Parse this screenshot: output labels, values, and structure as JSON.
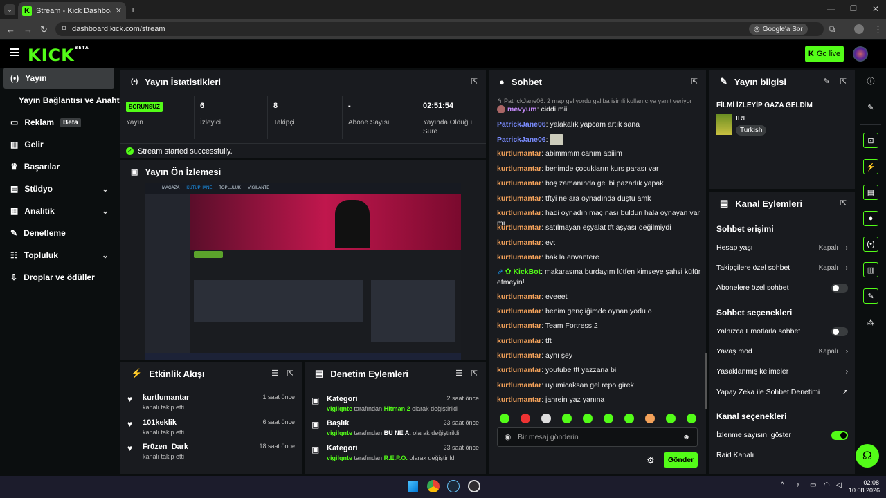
{
  "browser": {
    "tab_title": "Stream - Kick Dashboard",
    "url": "dashboard.kick.com/stream",
    "ask_google": "Google'a Sor"
  },
  "header": {
    "logo": "KICK",
    "logo_badge": "BETA",
    "go_live": "Go live"
  },
  "sidebar": {
    "items": [
      {
        "label": "Yayın",
        "icon": "broadcast-icon"
      },
      {
        "label": "Yayın Bağlantısı ve Anahtarı",
        "icon": ""
      },
      {
        "label": "Reklam",
        "badge": "Beta",
        "icon": "ad-icon"
      },
      {
        "label": "Gelir",
        "icon": "revenue-icon"
      },
      {
        "label": "Başarılar",
        "icon": "trophy-icon"
      },
      {
        "label": "Stüdyo",
        "icon": "studio-icon"
      },
      {
        "label": "Analitik",
        "icon": "analytics-icon"
      },
      {
        "label": "Denetleme",
        "icon": "wrench-icon"
      },
      {
        "label": "Topluluk",
        "icon": "community-icon"
      },
      {
        "label": "Droplar ve ödüller",
        "icon": "drops-icon"
      }
    ]
  },
  "stats": {
    "title": "Yayın İstatistikleri",
    "status": "SORUNSUZ",
    "status_label": "Yayın",
    "items": [
      {
        "value": "6",
        "label": "İzleyici"
      },
      {
        "value": "8",
        "label": "Takipçi"
      },
      {
        "value": "-",
        "label": "Abone Sayısı"
      },
      {
        "value": "02:51:54",
        "label": "Yayında Olduğu Süre"
      }
    ],
    "toast": "Stream started successfully."
  },
  "preview": {
    "title": "Yayın Ön İzlemesi",
    "tabs": [
      "MAĞAZA",
      "KÜTÜPHANE",
      "TOPLULUK",
      "VİGİLANTE"
    ]
  },
  "feed": {
    "title": "Etkinlik Akışı",
    "items": [
      {
        "name": "kurtlumantar",
        "sub": "kanalı takip etti",
        "time": "1 saat önce"
      },
      {
        "name": "101keklik",
        "sub": "kanalı takip etti",
        "time": "6 saat önce"
      },
      {
        "name": "Fr0zen_Dark",
        "sub": "kanalı takip etti",
        "time": "18 saat önce"
      }
    ]
  },
  "mod": {
    "title": "Denetim Eylemleri",
    "items": [
      {
        "type": "Kategori",
        "user": "vigilqnte",
        "mid": "tarafından",
        "value": "Hitman 2",
        "tail": "olarak değiştirildi",
        "time": "2 saat önce"
      },
      {
        "type": "Başlık",
        "user": "vigilqnte",
        "mid": "tarafından",
        "value": "BU NE A.",
        "tail": "olarak değiştirildi",
        "time": "23 saat önce"
      },
      {
        "type": "Kategori",
        "user": "vigilqnte",
        "mid": "tarafından",
        "value": "R.E.P.O.",
        "tail": "olarak değiştirildi",
        "time": "23 saat önce"
      }
    ]
  },
  "chat": {
    "title": "Sohbet",
    "reply": "PatrickJane06: 2 map geliyordu galiba isimli kullanıcıya yanıt veriyor",
    "messages": [
      {
        "user": "mevyum",
        "text": "ciddi miii",
        "color": "#c58af9"
      },
      {
        "user": "PatrickJane06",
        "text": "yalakalık yapcam artık sana",
        "color": "#7a8cff"
      },
      {
        "user": "PatrickJane06",
        "text": "",
        "color": "#7a8cff"
      },
      {
        "user": "kurtlumantar",
        "text": "abimmmm canım abiiim",
        "color": "#f4a25a"
      },
      {
        "user": "kurtlumantar",
        "text": "benimde çocukların kurs parası var",
        "color": "#f4a25a"
      },
      {
        "user": "kurtlumantar",
        "text": "boş zamanında gel bi pazarlık yapak",
        "color": "#f4a25a"
      },
      {
        "user": "kurtlumantar",
        "text": "tftyi ne ara oynadında düştü amk",
        "color": "#f4a25a"
      },
      {
        "user": "kurtlumantar",
        "text": "hadi oynadın maç nası buldun hala oynayan var mı",
        "color": "#f4a25a"
      },
      {
        "user": "kurtlumantar",
        "text": "satılmayan eşyalat tft aşyası değilmiydi",
        "color": "#f4a25a"
      },
      {
        "user": "kurtlumantar",
        "text": "evt",
        "color": "#f4a25a"
      },
      {
        "user": "kurtlumantar",
        "text": "bak la envantere",
        "color": "#f4a25a"
      },
      {
        "user": "KickBot",
        "text": "makarasına burdayım lütfen kimseye şahsi küfür etmeyin!",
        "color": "#53fc18"
      },
      {
        "user": "kurtlumantar",
        "text": "eveeet",
        "color": "#f4a25a"
      },
      {
        "user": "kurtlumantar",
        "text": "benim gençliğimde oynanıyodu o",
        "color": "#f4a25a"
      },
      {
        "user": "kurtlumantar",
        "text": "Team Fortress 2",
        "color": "#f4a25a"
      },
      {
        "user": "kurtlumantar",
        "text": "tft",
        "color": "#f4a25a"
      },
      {
        "user": "kurtlumantar",
        "text": "aynı şey",
        "color": "#f4a25a"
      },
      {
        "user": "kurtlumantar",
        "text": "youtube tft yazzana bi",
        "color": "#f4a25a"
      },
      {
        "user": "kurtlumantar",
        "text": "uyumicaksan gel repo girek",
        "color": "#f4a25a"
      },
      {
        "user": "kurtlumantar",
        "text": "jahrein yaz yanına",
        "color": "#f4a25a"
      }
    ],
    "placeholder": "Bir mesaj gönderin",
    "send": "Gönder"
  },
  "info": {
    "title": "Yayın bilgisi",
    "stream_title": "FİLMİ İZLEYİP GAZA GELDİM",
    "category": "IRL",
    "tag": "Turkish"
  },
  "actions": {
    "title": "Kanal Eylemleri",
    "access_title": "Sohbet erişimi",
    "access": [
      {
        "label": "Hesap yaşı",
        "value": "Kapalı"
      },
      {
        "label": "Takipçilere özel sohbet",
        "value": "Kapalı"
      },
      {
        "label": "Abonelere özel sohbet",
        "value": ""
      }
    ],
    "options_title": "Sohbet seçenekleri",
    "options": [
      {
        "label": "Yalnızca Emotlarla sohbet",
        "value": ""
      },
      {
        "label": "Yavaş mod",
        "value": "Kapalı"
      },
      {
        "label": "Yasaklanmış kelimeler",
        "value": ""
      },
      {
        "label": "Yapay Zeka ile Sohbet Denetimi",
        "value": ""
      }
    ],
    "channel_title": "Kanal seçenekleri",
    "channel": [
      {
        "label": "İzlenme sayısını göster"
      },
      {
        "label": "Raid Kanalı"
      }
    ]
  },
  "taskbar": {
    "time": "02:08",
    "date": "10.08.2026"
  }
}
